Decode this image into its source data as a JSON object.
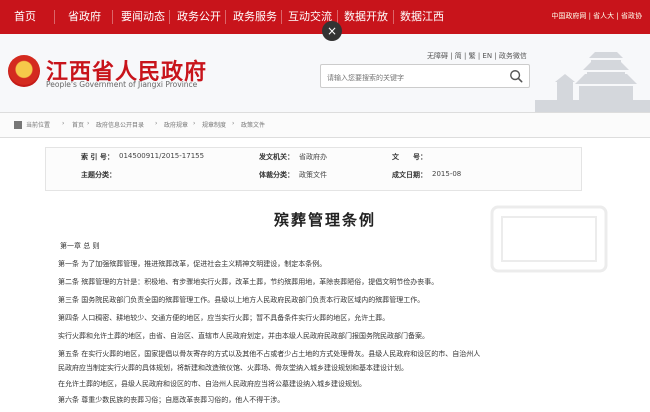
{
  "nav": {
    "items": [
      "首页",
      "省政府",
      "要闻动态",
      "政务公开",
      "政务服务",
      "互动交流",
      "数据开放",
      "数据江西"
    ],
    "right_links": "中国政府网 | 省人大 | 省政协"
  },
  "header": {
    "title": "江西省人民政府",
    "subtitle": "People's Government of Jiangxi Province",
    "links": "无障碍 | 简 | 繁 | EN | 政务微信",
    "search_placeholder": "请输入您要搜索的关键字"
  },
  "breadcrumb": [
    "当前位置",
    "首页",
    "政府信息公开目录",
    "政府规章",
    "规章制度",
    "政策文件"
  ],
  "meta": {
    "index_label": "索 引 号：",
    "index_value": "014500911/2015-17155",
    "issuer_label": "发文机关：",
    "issuer_value": "省政府办",
    "docno_label": "文　　号：",
    "docno_value": "",
    "topic_label": "主题分类：",
    "topic_value": "",
    "type_label": "体裁分类：",
    "type_value": "政策文件",
    "date_label": "成文日期：",
    "date_value": "2015-08"
  },
  "document": {
    "title": "殡葬管理条例",
    "paragraphs": [
      "第一章  总  则",
      "第一条  为了加强殡葬管理，推进殡葬改革，促进社会主义精神文明建设，制定本条例。",
      "第二条  殡葬管理的方针是：积极地、有步骤地实行火葬，改革土葬，节约殡葬用地，革除丧葬陋俗，提倡文明节俭办丧事。",
      "第三条  国务院民政部门负责全国的殡葬管理工作。县级以上地方人民政府民政部门负责本行政区域内的殡葬管理工作。",
      "第四条  人口稠密、耕地较少、交通方便的地区，应当实行火葬；暂不具备条件实行火葬的地区，允许土葬。",
      "实行火葬和允许土葬的地区，由省、自治区、直辖市人民政府划定，并由本级人民政府民政部门报国务院民政部门备案。",
      "第五条  在实行火葬的地区，国家提倡以骨灰寄存的方式以及其他不占或者少占土地的方式处理骨灰。县级人民政府和设区的市、自治州人",
      "民政府应当制定实行火葬的具体规划，将新建和改造殡仪馆、火葬场、骨灰堂纳入城乡建设规划和基本建设计划。",
      "在允许土葬的地区，县级人民政府和设区的市、自治州人民政府应当将公墓建设纳入城乡建设规划。",
      "第六条  尊重少数民族的丧葬习俗；自愿改革丧葬习俗的，他人不得干涉。"
    ]
  }
}
